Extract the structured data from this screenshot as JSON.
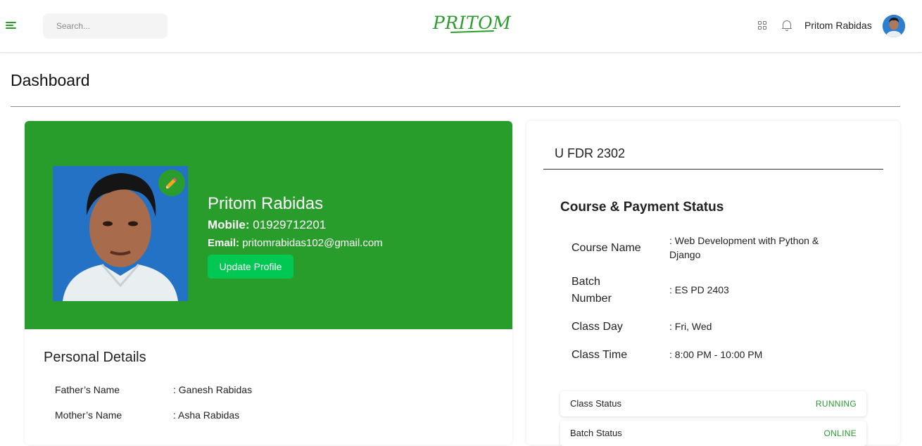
{
  "header": {
    "search_placeholder": "Search...",
    "logo_text": "PRITOM",
    "user_name": "Pritom Rabidas",
    "accent_color": "#299d2c"
  },
  "page": {
    "title": "Dashboard"
  },
  "profile": {
    "name": "Pritom Rabidas",
    "mobile_label": "Mobile:",
    "mobile": "01929712201",
    "email_label": "Email:",
    "email": "pritomrabidas102@gmail.com",
    "update_button": "Update Profile"
  },
  "personal_details": {
    "title": "Personal Details",
    "rows": [
      {
        "label": "Father’s Name",
        "value": ": Ganesh Rabidas"
      },
      {
        "label": "Mother’s Name",
        "value": ": Asha Rabidas"
      }
    ]
  },
  "course": {
    "batch_code": "U FDR 2302",
    "section_title": "Course & Payment Status",
    "rows": [
      {
        "label": "Course Name",
        "value": ": Web Development with Python & Django"
      },
      {
        "label": "Batch Number",
        "value": ": ES PD 2403"
      },
      {
        "label": "Class Day",
        "value": ": Fri, Wed"
      },
      {
        "label": "Class Time",
        "value": ": 8:00 PM - 10:00 PM"
      }
    ],
    "statuses": [
      {
        "label": "Class Status",
        "value": "RUNNING"
      },
      {
        "label": "Batch Status",
        "value": "ONLINE"
      }
    ]
  }
}
